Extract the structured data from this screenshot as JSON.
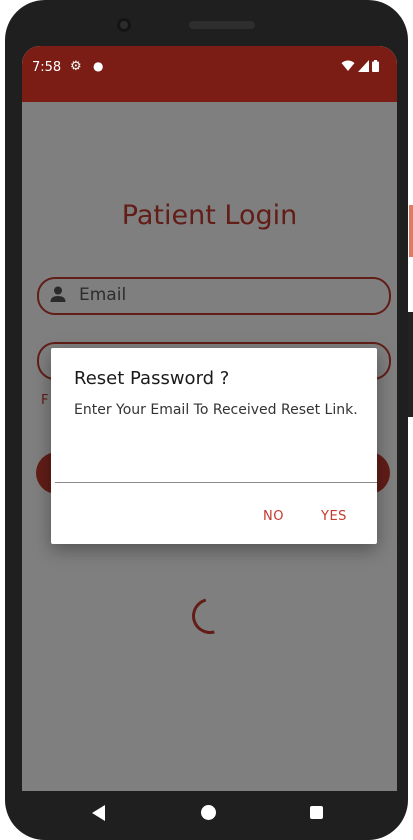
{
  "status_bar": {
    "time": "7:58",
    "color": "#7b1d15"
  },
  "login": {
    "title": "Patient Login",
    "email_placeholder": "Email",
    "forgot_text": "F",
    "accent_color": "#c43a2e"
  },
  "dialog": {
    "title": "Reset Password ?",
    "message": "Enter Your Email To Received Reset Link.",
    "input_value": "",
    "no_label": "NO",
    "yes_label": "YES"
  },
  "icons": [
    "settings-icon",
    "notification-dot-icon",
    "wifi-icon",
    "signal-icon",
    "battery-icon",
    "person-icon",
    "back-icon",
    "home-icon",
    "recents-icon"
  ]
}
